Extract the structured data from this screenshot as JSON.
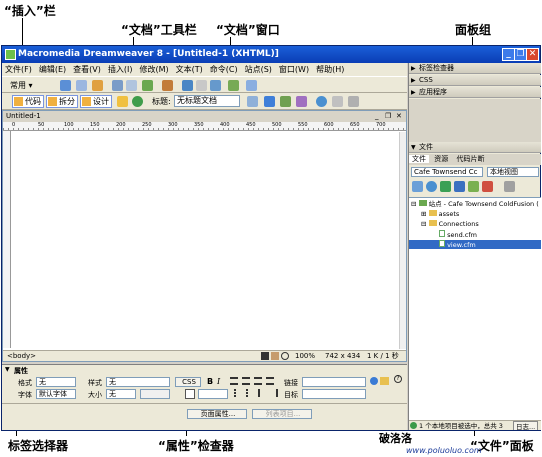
{
  "callouts": {
    "insert_bar": "“插入”栏",
    "doc_toolbar": "“文档”工具栏",
    "doc_window": "“文档”窗口",
    "panel_group": "面板组",
    "tag_selector": "标签选择器",
    "property_inspector": "“属性”检查器",
    "files_panel": "“文件”面板"
  },
  "window": {
    "title": "Macromedia Dreamweaver 8 - [Untitled-1 (XHTML)]",
    "min": "_",
    "max": "❐",
    "close": "✕"
  },
  "menu": [
    "文件(F)",
    "编辑(E)",
    "查看(V)",
    "插入(I)",
    "修改(M)",
    "文本(T)",
    "命令(C)",
    "站点(S)",
    "窗口(W)",
    "帮助(H)"
  ],
  "insert_bar": {
    "category": "常用 ▾"
  },
  "doc_toolbar": {
    "code_btn": "代码",
    "split_btn": "拆分",
    "design_btn": "设计",
    "title_label": "标题:",
    "title_value": "无标题文档"
  },
  "doc_window": {
    "tab": "Untitled-1",
    "ruler_ticks": [
      "0",
      "50",
      "100",
      "150",
      "200",
      "250",
      "300",
      "350",
      "400",
      "450",
      "500",
      "550",
      "600",
      "650",
      "700"
    ],
    "status_tag": "<body>",
    "zoom": "100%",
    "size": "742 x 434",
    "weight": "1 K / 1 秒"
  },
  "properties": {
    "title": "属性",
    "format_label": "格式",
    "format_value": "无",
    "style_label": "样式",
    "style_value": "无",
    "css_btn": "CSS",
    "link_label": "链接",
    "font_label": "字体",
    "font_value": "默认字体",
    "size_label": "大小",
    "size_value": "无",
    "target_label": "目标",
    "page_props_btn": "页面属性...",
    "list_item_btn": "列表项目..."
  },
  "panels": {
    "groups": [
      "标签检查器",
      "CSS",
      "应用程序"
    ],
    "files_group": "文件",
    "files_tabs": [
      "文件",
      "资源",
      "代码片断"
    ],
    "site_select": "Cafe Townsend Cc",
    "view_select": "本地视图",
    "tree": [
      {
        "label": "站点 - Cafe Townsend ColdFusion (",
        "level": 0,
        "type": "site"
      },
      {
        "label": "assets",
        "level": 1,
        "type": "folder"
      },
      {
        "label": "Connections",
        "level": 1,
        "type": "folder"
      },
      {
        "label": "send.cfm",
        "level": 2,
        "type": "file"
      },
      {
        "label": "view.cfm",
        "level": 2,
        "type": "file",
        "selected": true
      }
    ],
    "status": "1 个本地项目被选中，总共 3",
    "log_btn": "日志..."
  },
  "watermark": {
    "name": "破洛洛",
    "url": "www.poluoluo.com"
  },
  "colors": {
    "title_bar": "#0a3db5",
    "selection": "#316ac5",
    "chrome": "#ece9d8"
  }
}
